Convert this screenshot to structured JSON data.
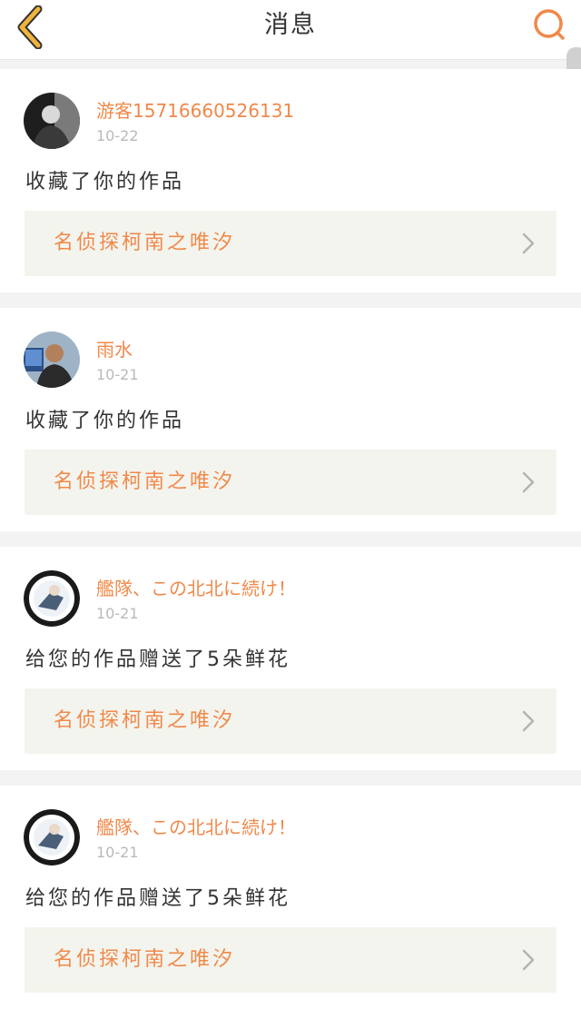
{
  "header": {
    "title": "消息",
    "back_icon": "chevron-left-icon",
    "search_icon": "search-icon",
    "accent_color": "#f0b43c",
    "search_color": "#f0894a"
  },
  "messages": [
    {
      "username": "游客15716660526131",
      "time": "10-22",
      "action": "收藏了你的作品",
      "work_title": "名侦探柯南之唯汐"
    },
    {
      "username": "雨水",
      "time": "10-21",
      "action": "收藏了你的作品",
      "work_title": "名侦探柯南之唯汐"
    },
    {
      "username": "艦隊、この北北に続け！",
      "time": "10-21",
      "action": "给您的作品赠送了5朵鲜花",
      "work_title": "名侦探柯南之唯汐"
    },
    {
      "username": "艦隊、この北北に続け！",
      "time": "10-21",
      "action": "给您的作品赠送了5朵鲜花",
      "work_title": "名侦探柯南之唯汐"
    }
  ]
}
